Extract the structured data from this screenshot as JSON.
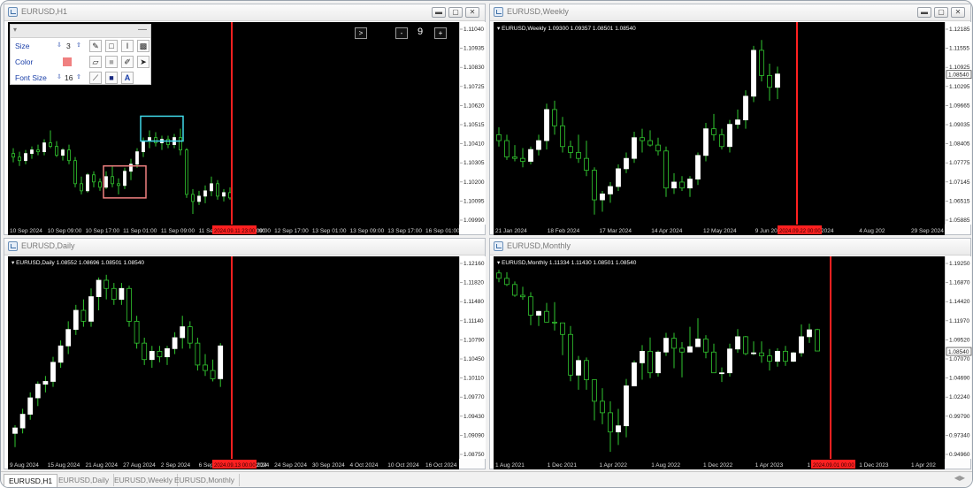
{
  "colors": {
    "up": "#ffffff",
    "wick": "#31c62f",
    "down_body": "#000000",
    "down_border": "#31c62f",
    "vline": "#ff2020",
    "bg": "#000000"
  },
  "windows": [
    {
      "id": "h1",
      "title": "EURUSD,H1",
      "ohlc": "",
      "y_ticks": [
        "1.11040",
        "1.10935",
        "1.10830",
        "1.10725",
        "1.10620",
        "1.10515",
        "1.10410",
        "1.10305",
        "1.10200",
        "1.10095",
        "1.09990"
      ],
      "ylim": [
        1.0999,
        1.1104
      ],
      "x_ticks": [
        "10 Sep 2024",
        "10 Sep 09:00",
        "10 Sep 17:00",
        "11 Sep 01:00",
        "11 Sep 09:00",
        "11 Se",
        "12 Sep 09:00",
        "12 Sep 17:00",
        "13 Sep 01:00",
        "13 Sep 09:00",
        "13 Sep 17:00",
        "16 Sep 01:00"
      ],
      "x_ticks_partial": [
        ":00"
      ],
      "current_price": "",
      "vline_label": "2024.09.11 23:00",
      "candles": [
        [
          1.1037,
          1.104,
          1.1032,
          1.1035
        ],
        [
          1.1035,
          1.1038,
          1.103,
          1.1033
        ],
        [
          1.1033,
          1.1039,
          1.1031,
          1.1037
        ],
        [
          1.1037,
          1.1041,
          1.1034,
          1.1039
        ],
        [
          1.1039,
          1.1042,
          1.1036,
          1.1038
        ],
        [
          1.1038,
          1.1045,
          1.1036,
          1.1043
        ],
        [
          1.1043,
          1.105,
          1.104,
          1.1041
        ],
        [
          1.1041,
          1.1044,
          1.1035,
          1.1036
        ],
        [
          1.1036,
          1.104,
          1.1033,
          1.1039
        ],
        [
          1.1039,
          1.1042,
          1.1031,
          1.1033
        ],
        [
          1.1033,
          1.1035,
          1.1018,
          1.102
        ],
        [
          1.102,
          1.1024,
          1.1014,
          1.1016
        ],
        [
          1.1016,
          1.1026,
          1.1015,
          1.1025
        ],
        [
          1.1025,
          1.1027,
          1.1018,
          1.1021
        ],
        [
          1.1021,
          1.1023,
          1.1016,
          1.1018
        ],
        [
          1.1018,
          1.1027,
          1.1017,
          1.1024
        ],
        [
          1.1024,
          1.103,
          1.1018,
          1.102
        ],
        [
          1.102,
          1.1023,
          1.1014,
          1.1019
        ],
        [
          1.1019,
          1.1029,
          1.1017,
          1.1027
        ],
        [
          1.1027,
          1.1034,
          1.1022,
          1.1031
        ],
        [
          1.1031,
          1.104,
          1.1029,
          1.1038
        ],
        [
          1.1038,
          1.1046,
          1.1035,
          1.1044
        ],
        [
          1.1044,
          1.105,
          1.104,
          1.1046
        ],
        [
          1.1046,
          1.1049,
          1.1041,
          1.1043
        ],
        [
          1.1043,
          1.1047,
          1.1039,
          1.1045
        ],
        [
          1.1045,
          1.1047,
          1.104,
          1.1042
        ],
        [
          1.1042,
          1.1048,
          1.104,
          1.1046
        ],
        [
          1.1046,
          1.1051,
          1.1036,
          1.1039
        ],
        [
          1.1039,
          1.104,
          1.1012,
          1.1014
        ],
        [
          1.1014,
          1.1017,
          1.1003,
          1.101
        ],
        [
          1.101,
          1.1016,
          1.1008,
          1.1013
        ],
        [
          1.1013,
          1.1019,
          1.1009,
          1.1016
        ],
        [
          1.1016,
          1.1024,
          1.1013,
          1.102
        ],
        [
          1.102,
          1.1022,
          1.1011,
          1.1013
        ],
        [
          1.1013,
          1.1017,
          1.101,
          1.1015
        ],
        [
          1.1015,
          1.1018,
          1.1011,
          1.1012
        ]
      ],
      "boxes": [
        {
          "color": "#f08080",
          "from": 15,
          "to": 21,
          "top": 1.103,
          "bottom": 1.1012
        },
        {
          "color": "#40d8e8",
          "from": 21,
          "to": 27,
          "top": 1.1058,
          "bottom": 1.1044
        }
      ]
    },
    {
      "id": "w1",
      "title": "EURUSD,Weekly",
      "ohlc": "EURUSD,Weekly  1.09300 1.09357 1.08501 1.08540",
      "y_ticks": [
        "1.12185",
        "1.11555",
        "1.10925",
        "1.10295",
        "1.09665",
        "1.09035",
        "1.08405",
        "1.07775",
        "1.07145",
        "1.06515",
        "1.05885"
      ],
      "ylim": [
        1.05885,
        1.12185
      ],
      "x_ticks": [
        "21 Jan 2024",
        "18 Feb 2024",
        "17 Mar 2024",
        "14 Apr 2024",
        "12 May 2024",
        "9 Jun 2024",
        "7 Jul 2024",
        "4 Aug 202",
        "29 Sep 2024"
      ],
      "current_price": "1.08540",
      "vline_label": "2024.09.22 00:00",
      "candles": [
        [
          1.088,
          1.0905,
          1.084,
          1.086
        ],
        [
          1.086,
          1.088,
          1.0795,
          1.0805
        ],
        [
          1.0805,
          1.0845,
          1.079,
          1.08
        ],
        [
          1.08,
          1.0835,
          1.077,
          1.079
        ],
        [
          1.079,
          1.084,
          1.078,
          1.083
        ],
        [
          1.083,
          1.088,
          1.081,
          1.086
        ],
        [
          1.086,
          1.0985,
          1.083,
          1.0965
        ],
        [
          1.0965,
          1.0995,
          1.088,
          1.091
        ],
        [
          1.091,
          1.094,
          1.082,
          1.084
        ],
        [
          1.084,
          1.086,
          1.08,
          1.082
        ],
        [
          1.082,
          1.088,
          1.0785,
          1.08
        ],
        [
          1.08,
          1.086,
          1.074,
          1.076
        ],
        [
          1.076,
          1.077,
          1.061,
          1.066
        ],
        [
          1.066,
          1.069,
          1.062,
          1.068
        ],
        [
          1.068,
          1.072,
          1.065,
          1.0705
        ],
        [
          1.0705,
          1.078,
          1.069,
          1.0765
        ],
        [
          1.0765,
          1.082,
          1.075,
          1.08
        ],
        [
          1.08,
          1.089,
          1.0785,
          1.087
        ],
        [
          1.087,
          1.09,
          1.082,
          1.086
        ],
        [
          1.086,
          1.0895,
          1.084,
          1.0845
        ],
        [
          1.0845,
          1.087,
          1.081,
          1.0825
        ],
        [
          1.0825,
          1.084,
          1.067,
          1.07
        ],
        [
          1.07,
          1.075,
          1.068,
          1.072
        ],
        [
          1.072,
          1.074,
          1.069,
          1.07
        ],
        [
          1.07,
          1.074,
          1.067,
          1.073
        ],
        [
          1.073,
          1.082,
          1.071,
          1.081
        ],
        [
          1.081,
          1.092,
          1.079,
          1.09
        ],
        [
          1.09,
          1.095,
          1.086,
          1.088
        ],
        [
          1.088,
          1.09,
          1.083,
          1.084
        ],
        [
          1.084,
          1.093,
          1.082,
          1.0915
        ],
        [
          1.0915,
          1.0965,
          1.09,
          1.093
        ],
        [
          1.093,
          1.103,
          1.09,
          1.101
        ],
        [
          1.101,
          1.118,
          1.099,
          1.1165
        ],
        [
          1.1165,
          1.12,
          1.106,
          1.108
        ],
        [
          1.108,
          1.112,
          1.0995,
          1.104
        ],
        [
          1.104,
          1.111,
          1.1,
          1.1085
        ]
      ]
    },
    {
      "id": "d1",
      "title": "EURUSD,Daily",
      "ohlc": "EURUSD,Daily  1.08552 1.08696 1.08501 1.08540",
      "y_ticks": [
        "1.12160",
        "1.11820",
        "1.11480",
        "1.11140",
        "1.10790",
        "1.10450",
        "1.10110",
        "1.09770",
        "1.09430",
        "1.09090",
        "1.08750"
      ],
      "ylim": [
        1.0875,
        1.1216
      ],
      "x_ticks": [
        "9 Aug 2024",
        "15 Aug 2024",
        "21 Aug 2024",
        "27 Aug 2024",
        "2 Sep 2024",
        "6 Sep",
        "18 Sep 2024",
        "24 Sep 2024",
        "30 Sep 2024",
        "4 Oct 2024",
        "10 Oct 2024",
        "16 Oct 2024"
      ],
      "x_ticks_partial": [
        "024"
      ],
      "current_price": "",
      "vline_label": "2024.09.13 00:00",
      "candles": [
        [
          1.0915,
          1.093,
          1.089,
          1.0925
        ],
        [
          1.0925,
          1.096,
          1.0915,
          1.095
        ],
        [
          1.095,
          1.099,
          1.094,
          1.098
        ],
        [
          1.098,
          1.101,
          1.0965,
          1.1005
        ],
        [
          1.1005,
          1.102,
          1.099,
          1.101
        ],
        [
          1.101,
          1.1055,
          1.1,
          1.1045
        ],
        [
          1.1045,
          1.1085,
          1.1035,
          1.1075
        ],
        [
          1.1075,
          1.112,
          1.106,
          1.1105
        ],
        [
          1.1105,
          1.115,
          1.1095,
          1.114
        ],
        [
          1.114,
          1.116,
          1.111,
          1.112
        ],
        [
          1.112,
          1.118,
          1.111,
          1.1165
        ],
        [
          1.1165,
          1.12,
          1.114,
          1.1195
        ],
        [
          1.1195,
          1.1205,
          1.116,
          1.118
        ],
        [
          1.118,
          1.119,
          1.115,
          1.116
        ],
        [
          1.116,
          1.119,
          1.115,
          1.118
        ],
        [
          1.118,
          1.1185,
          1.111,
          1.112
        ],
        [
          1.112,
          1.113,
          1.107,
          1.108
        ],
        [
          1.108,
          1.109,
          1.104,
          1.105
        ],
        [
          1.105,
          1.1075,
          1.1035,
          1.1065
        ],
        [
          1.1065,
          1.1075,
          1.1045,
          1.1055
        ],
        [
          1.1055,
          1.1075,
          1.104,
          1.107
        ],
        [
          1.107,
          1.11,
          1.106,
          1.109
        ],
        [
          1.109,
          1.113,
          1.107,
          1.111
        ],
        [
          1.111,
          1.112,
          1.107,
          1.108
        ],
        [
          1.108,
          1.109,
          1.103,
          1.104
        ],
        [
          1.104,
          1.106,
          1.102,
          1.103
        ],
        [
          1.103,
          1.105,
          1.101,
          1.1015
        ],
        [
          1.1015,
          1.108,
          1.1,
          1.1075
        ]
      ]
    },
    {
      "id": "mn",
      "title": "EURUSD,Monthly",
      "ohlc": "EURUSD,Monthly  1.11334 1.11430 1.08501 1.08540",
      "y_ticks": [
        "1.19250",
        "1.16870",
        "1.14420",
        "1.11970",
        "1.09520",
        "1.07070",
        "1.04690",
        "1.02240",
        "0.99790",
        "0.97340",
        "0.94960"
      ],
      "ylim": [
        0.9496,
        1.1925
      ],
      "x_ticks": [
        "1 Aug 2021",
        "1 Dec 2021",
        "1 Apr 2022",
        "1 Aug 2022",
        "1 Dec 2022",
        "1 Apr 2023",
        "1 Aug 2023",
        "1 Dec 2023",
        "1 Apr 202"
      ],
      "x_ticks_partial": [],
      "current_price": "1.08540",
      "vline_label": "2024.09.01 00:00",
      "candles": [
        [
          1.187,
          1.191,
          1.175,
          1.18
        ],
        [
          1.18,
          1.188,
          1.17,
          1.172
        ],
        [
          1.172,
          1.176,
          1.156,
          1.158
        ],
        [
          1.158,
          1.169,
          1.152,
          1.156
        ],
        [
          1.156,
          1.162,
          1.119,
          1.132
        ],
        [
          1.132,
          1.138,
          1.118,
          1.137
        ],
        [
          1.137,
          1.148,
          1.123,
          1.123
        ],
        [
          1.123,
          1.149,
          1.112,
          1.122
        ],
        [
          1.122,
          1.118,
          1.08,
          1.107
        ],
        [
          1.107,
          1.118,
          1.046,
          1.054
        ],
        [
          1.054,
          1.079,
          1.035,
          1.073
        ],
        [
          1.073,
          1.077,
          1.035,
          1.048
        ],
        [
          1.048,
          1.048,
          0.995,
          1.02
        ],
        [
          1.02,
          1.037,
          0.99,
          1.005
        ],
        [
          1.005,
          1.02,
          0.954,
          0.98
        ],
        [
          0.98,
          1.01,
          0.963,
          0.988
        ],
        [
          0.988,
          1.049,
          0.973,
          1.04
        ],
        [
          1.04,
          1.073,
          1.04,
          1.07
        ],
        [
          1.07,
          1.093,
          1.048,
          1.085
        ],
        [
          1.085,
          1.103,
          1.05,
          1.057
        ],
        [
          1.057,
          1.086,
          1.052,
          1.084
        ],
        [
          1.084,
          1.109,
          1.079,
          1.102
        ],
        [
          1.102,
          1.109,
          1.063,
          1.089
        ],
        [
          1.089,
          1.097,
          1.051,
          1.084
        ],
        [
          1.084,
          1.117,
          1.084,
          1.091
        ],
        [
          1.091,
          1.128,
          1.091,
          1.101
        ],
        [
          1.101,
          1.106,
          1.076,
          1.084
        ],
        [
          1.084,
          1.095,
          1.058,
          1.057
        ],
        [
          1.057,
          1.064,
          1.045,
          1.057
        ],
        [
          1.057,
          1.095,
          1.052,
          1.088
        ],
        [
          1.088,
          1.114,
          1.083,
          1.104
        ],
        [
          1.104,
          1.105,
          1.08,
          1.082
        ],
        [
          1.082,
          1.098,
          1.08,
          1.083
        ],
        [
          1.083,
          1.098,
          1.07,
          1.079
        ],
        [
          1.079,
          1.088,
          1.06,
          1.072
        ],
        [
          1.072,
          1.089,
          1.065,
          1.085
        ],
        [
          1.085,
          1.092,
          1.066,
          1.072
        ],
        [
          1.072,
          1.084,
          1.071,
          1.083
        ],
        [
          1.083,
          1.12,
          1.078,
          1.104
        ],
        [
          1.104,
          1.121,
          1.096,
          1.113
        ],
        [
          1.1133,
          1.1143,
          1.085,
          1.0854
        ]
      ]
    }
  ],
  "toolbox": {
    "size_label": "Size",
    "size_value": "3",
    "color_label": "Color",
    "color_value": "#f08080",
    "font_label": "Font Size",
    "font_value": "16",
    "minimize_label": "—"
  },
  "overlay": {
    "next_label": ">",
    "minus_label": "-",
    "count": "9",
    "plus_label": "+"
  },
  "tabs": [
    {
      "label": "EURUSD,H1",
      "active": true
    },
    {
      "label": "EURUSD,Daily",
      "active": false
    },
    {
      "label": "EURUSD,Weekly",
      "active": false
    },
    {
      "label": "EURUSD,Monthly",
      "active": false
    }
  ]
}
